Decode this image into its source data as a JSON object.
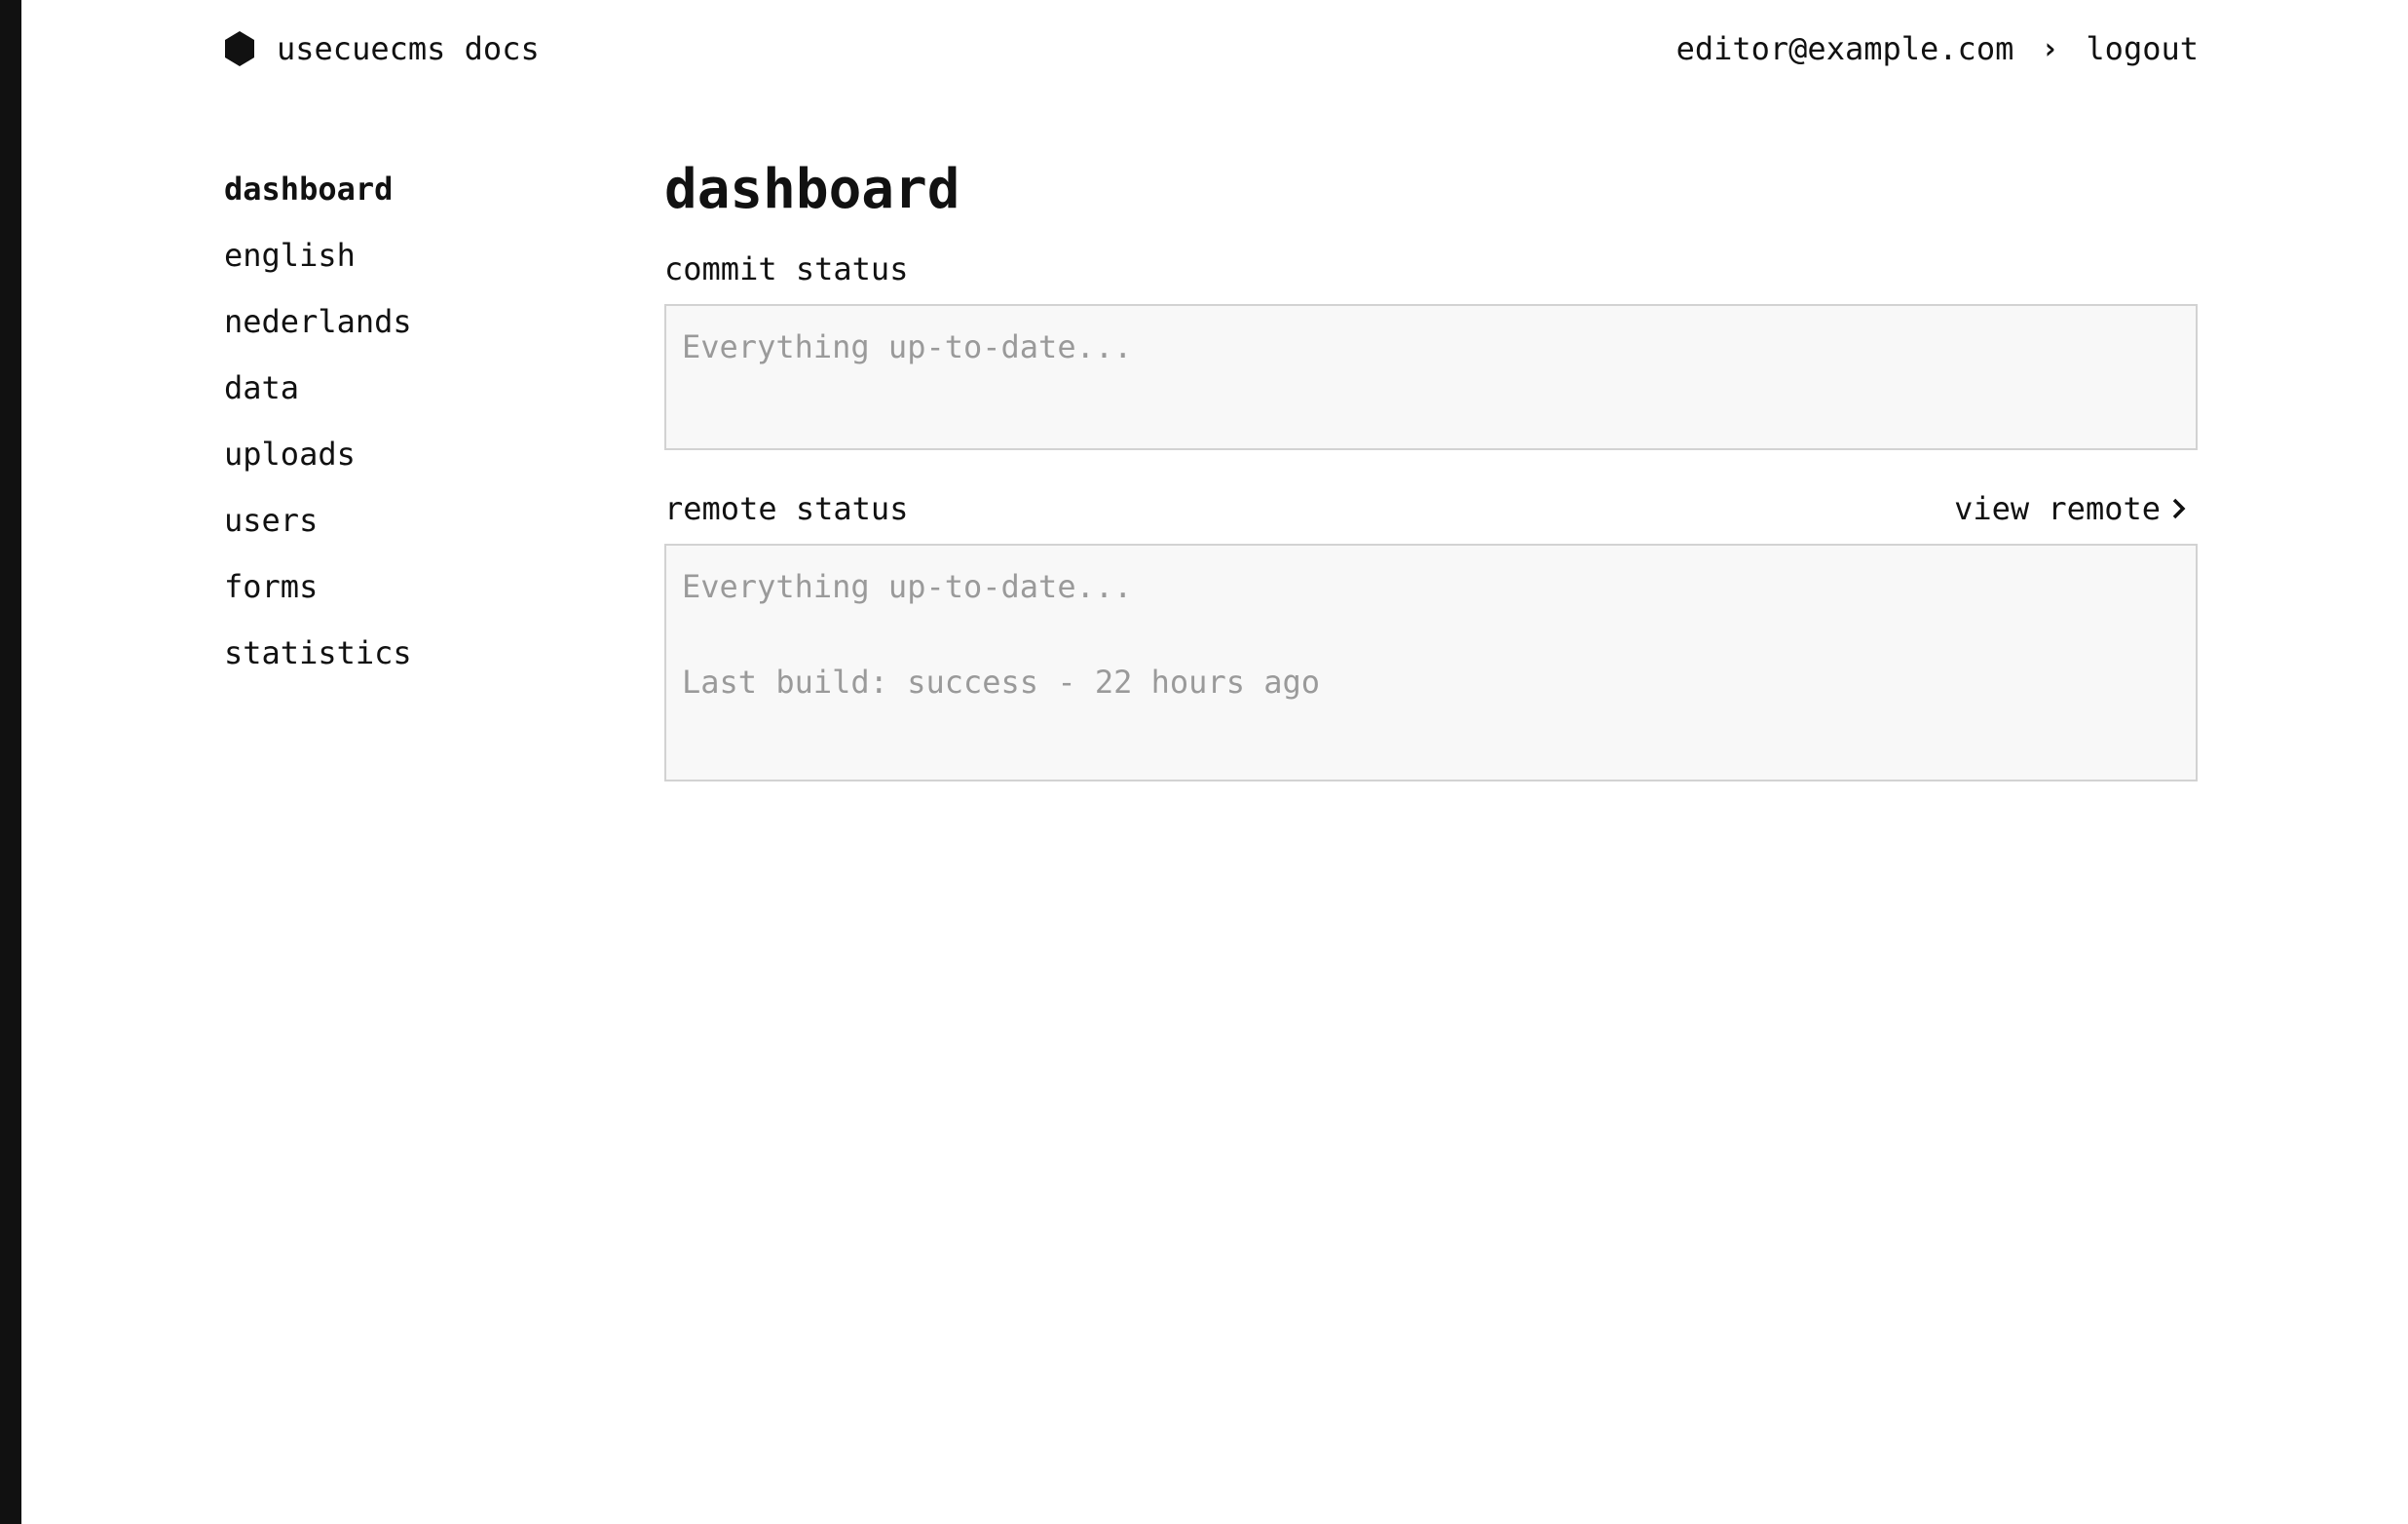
{
  "header": {
    "brand_name": "usecuecms docs",
    "user_email": "editor@example.com",
    "logout_label": "logout"
  },
  "sidebar": {
    "items": [
      {
        "label": "dashboard",
        "active": true
      },
      {
        "label": "english"
      },
      {
        "label": "nederlands"
      },
      {
        "label": "data"
      },
      {
        "label": "uploads"
      },
      {
        "label": "users"
      },
      {
        "label": "forms"
      },
      {
        "label": "statistics"
      }
    ]
  },
  "main": {
    "title": "dashboard",
    "commit": {
      "heading": "commit status",
      "message": "Everything up-to-date..."
    },
    "remote": {
      "heading": "remote status",
      "link_label": "view remote",
      "message": "Everything up-to-date...",
      "last_build": "Last build: success - 22 hours ago"
    }
  },
  "icons": {
    "brand": "hexagon-icon",
    "separator": "chevron-right-icon",
    "view_remote": "chevron-right-icon"
  },
  "colors": {
    "text": "#111111",
    "muted_text": "#9a9a9a",
    "box_background": "#f8f8f8",
    "box_border": "#d2d2d2",
    "edge_bar": "#111111"
  }
}
